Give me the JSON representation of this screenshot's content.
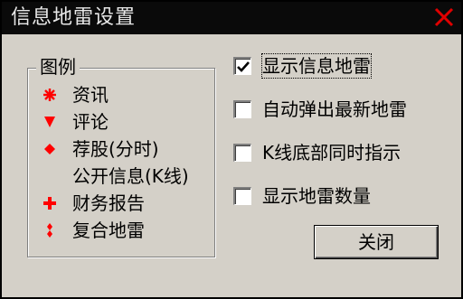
{
  "window": {
    "title": "信息地雷设置",
    "close_icon": "close-icon"
  },
  "legend": {
    "title": "图例",
    "items": [
      {
        "label": "资讯",
        "icon": "star-burst-icon",
        "color": "#ff0000"
      },
      {
        "label": "评论",
        "icon": "triangle-down-icon",
        "color": "#ff0000"
      },
      {
        "label": "荐股(分时)",
        "icon": "diamond-icon",
        "color": "#ff0000"
      },
      {
        "label": "公开信息(K线)",
        "icon": "",
        "color": ""
      },
      {
        "label": "财务报告",
        "icon": "plus-icon",
        "color": "#ff0000"
      },
      {
        "label": "复合地雷",
        "icon": "double-diamond-icon",
        "color": "#ff0000"
      }
    ]
  },
  "options": [
    {
      "label": "显示信息地雷",
      "checked": true
    },
    {
      "label": "自动弹出最新地雷",
      "checked": false
    },
    {
      "label": "K线底部同时指示",
      "checked": false
    },
    {
      "label": "显示地雷数量",
      "checked": false
    }
  ],
  "buttons": {
    "close_label": "关闭"
  }
}
